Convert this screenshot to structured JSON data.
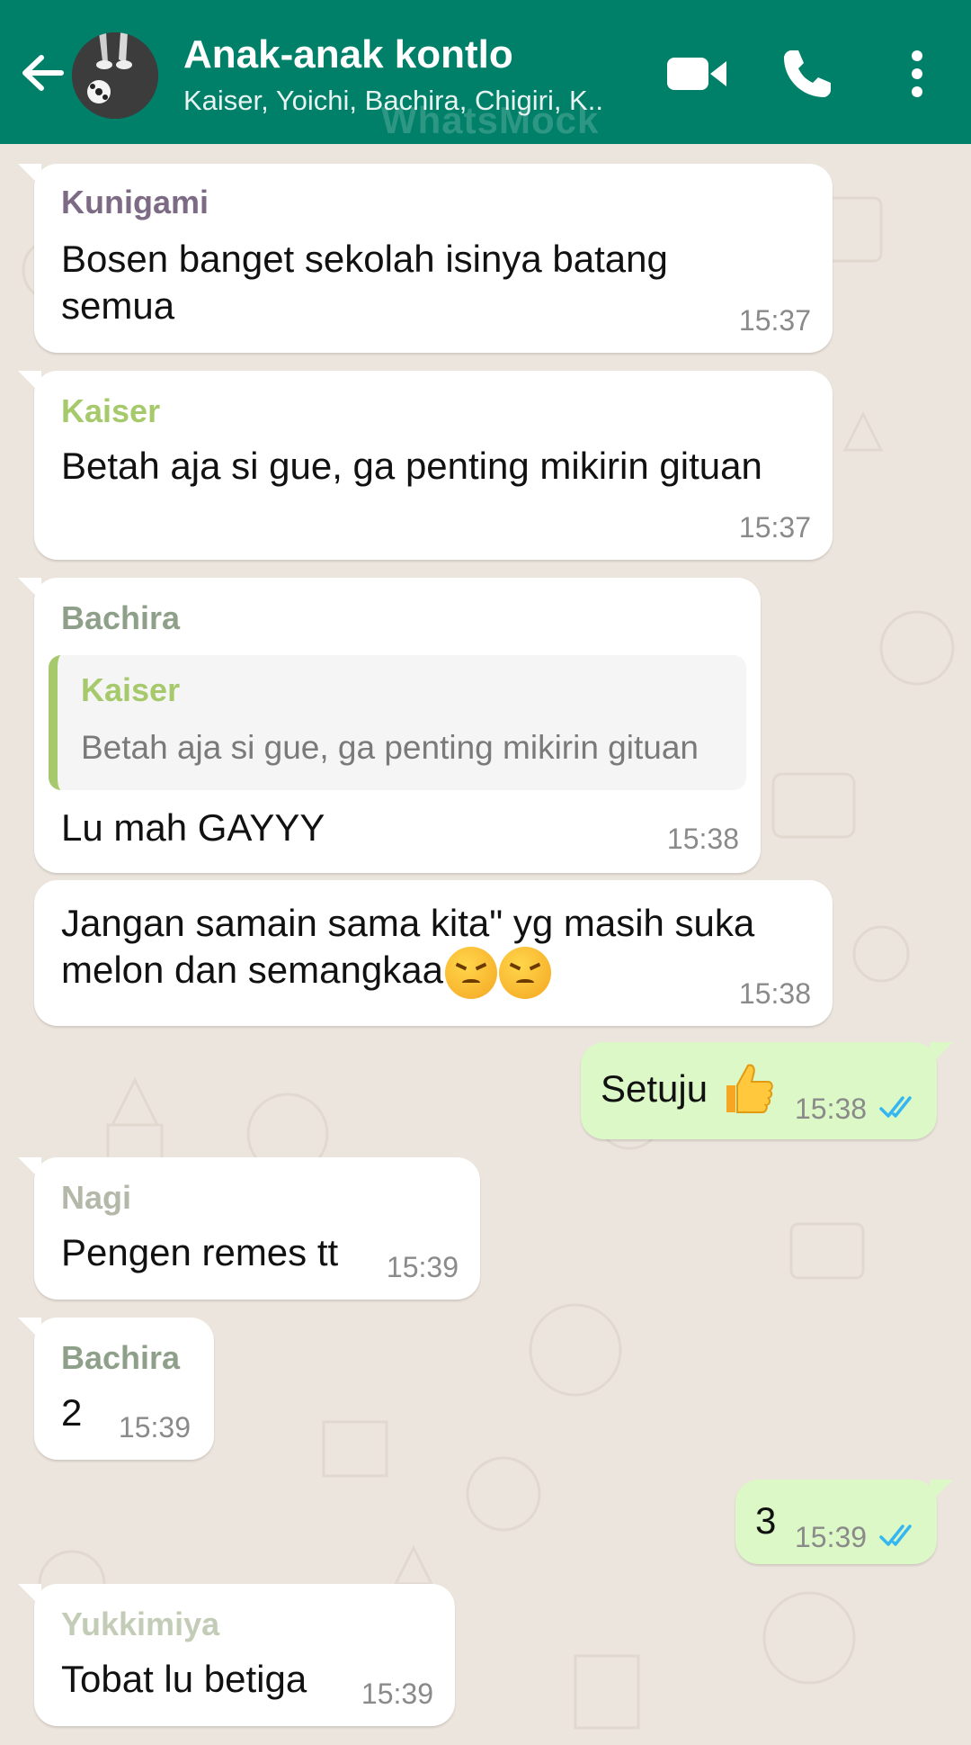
{
  "header": {
    "title": "Anak-anak kontlo",
    "subtitle": "Kaiser, Yoichi, Bachira, Chigiri, K..",
    "watermark": "WhatsMock",
    "icons": [
      "back-arrow-icon",
      "group-avatar",
      "video-call-icon",
      "phone-icon",
      "more-vert-icon"
    ]
  },
  "colors": {
    "header_bg": "#008069",
    "chat_bg": "#ece5dd",
    "incoming_bubble": "#ffffff",
    "outgoing_bubble": "#dcf8c6",
    "read_ticks": "#34b7f1"
  },
  "messages": [
    {
      "direction": "in",
      "sender": "Kunigami",
      "sender_color": "#7d6b86",
      "text": "Bosen banget sekolah isinya batang semua",
      "time": "15:37"
    },
    {
      "direction": "in",
      "sender": "Kaiser",
      "sender_color": "#a6c96b",
      "text": "Betah aja si gue, ga penting mikirin gituan",
      "time": "15:37"
    },
    {
      "direction": "in",
      "sender": "Bachira",
      "sender_color": "#8fa08a",
      "quote": {
        "sender": "Kaiser",
        "text": "Betah aja si gue, ga penting mikirin gituan"
      },
      "text": "Lu mah GAYYY",
      "time": "15:38"
    },
    {
      "direction": "in",
      "sender": "",
      "text": "Jangan samain sama kita\" yg masih suka melon dan semangkaa",
      "emoji": [
        "persevering-face-emoji",
        "persevering-face-emoji"
      ],
      "time": "15:38"
    },
    {
      "direction": "out",
      "text": "Setuju",
      "emoji": [
        "thumbs-up-emoji"
      ],
      "time": "15:38",
      "status": "read"
    },
    {
      "direction": "in",
      "sender": "Nagi",
      "sender_color": "#b3b8a8",
      "text": "Pengen remes tt",
      "time": "15:39"
    },
    {
      "direction": "in",
      "sender": "Bachira",
      "sender_color": "#8fa08a",
      "text": "2",
      "time": "15:39"
    },
    {
      "direction": "out",
      "text": "3",
      "time": "15:39",
      "status": "read"
    },
    {
      "direction": "in",
      "sender": "Yukkimiya",
      "sender_color": "#c2ccb6",
      "text": "Tobat lu betiga",
      "time": "15:39"
    }
  ]
}
